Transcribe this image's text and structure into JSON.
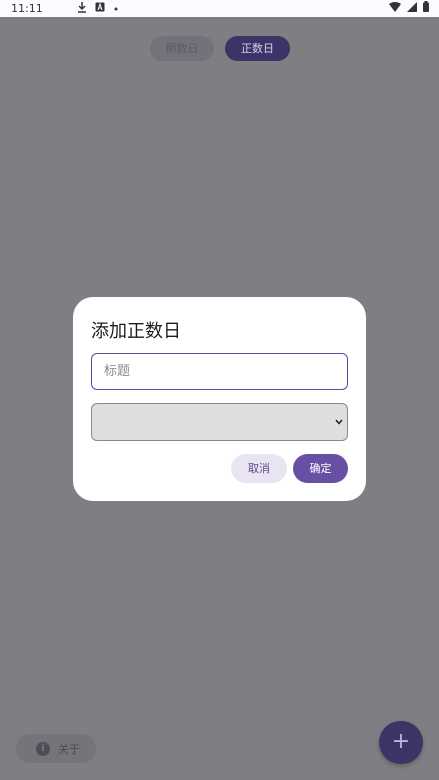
{
  "status_bar": {
    "time": "11:11"
  },
  "tabs": [
    {
      "label": "倒数日"
    },
    {
      "label": "正数日"
    }
  ],
  "about_button": {
    "label": "关于"
  },
  "fab": {
    "label": "+"
  },
  "dialog": {
    "title": "添加正数日",
    "title_input": {
      "placeholder": "标题",
      "value": ""
    },
    "date_select": {
      "value": ""
    },
    "cancel_label": "取消",
    "confirm_label": "确定"
  },
  "colors": {
    "accent": "#6750a4",
    "scrim": "#7f7e82"
  },
  "icons": [
    "download-icon",
    "a-icon",
    "dot-icon",
    "wifi-icon",
    "signal-icon",
    "battery-icon",
    "info-icon",
    "plus-icon",
    "chevron-down-icon"
  ]
}
